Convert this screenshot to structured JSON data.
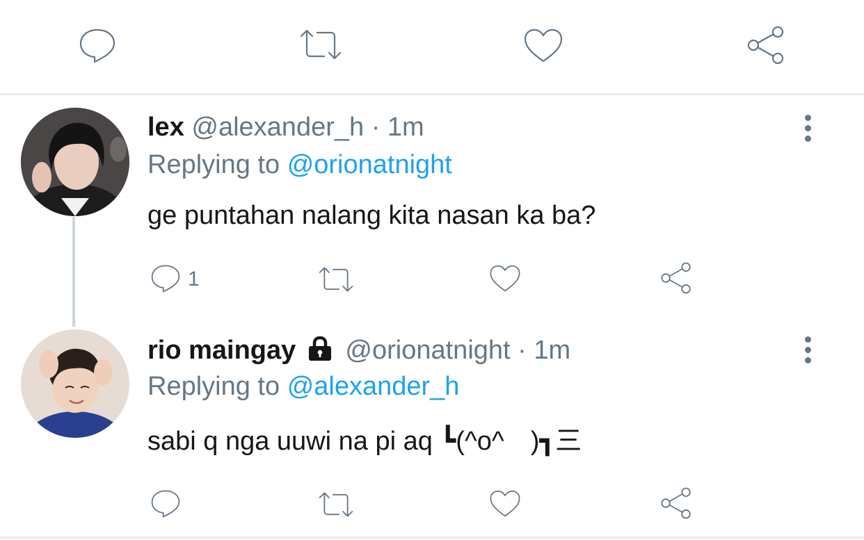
{
  "top_actions": {
    "reply_icon": "reply-icon",
    "retweet_icon": "retweet-icon",
    "like_icon": "heart-icon",
    "share_icon": "share-icon"
  },
  "tweets": [
    {
      "display_name": "lex",
      "handle": "@alexander_h",
      "separator": "·",
      "time": "1m",
      "replying_prefix": "Replying to",
      "replying_to": "@orionatnight",
      "text": "ge puntahan nalang kita nasan ka ba?",
      "reply_count": "1",
      "locked": false
    },
    {
      "display_name": "rio maingay",
      "handle": "@orionatnight",
      "separator": "·",
      "time": "1m",
      "replying_prefix": "Replying to",
      "replying_to": "@alexander_h",
      "text": "sabi q nga uuwi na pi aq ┗(^o^　)┓三",
      "reply_count": "",
      "locked": true
    }
  ],
  "colors": {
    "link": "#1da1f2",
    "muted": "#657786",
    "divider": "#e6ecf0"
  }
}
